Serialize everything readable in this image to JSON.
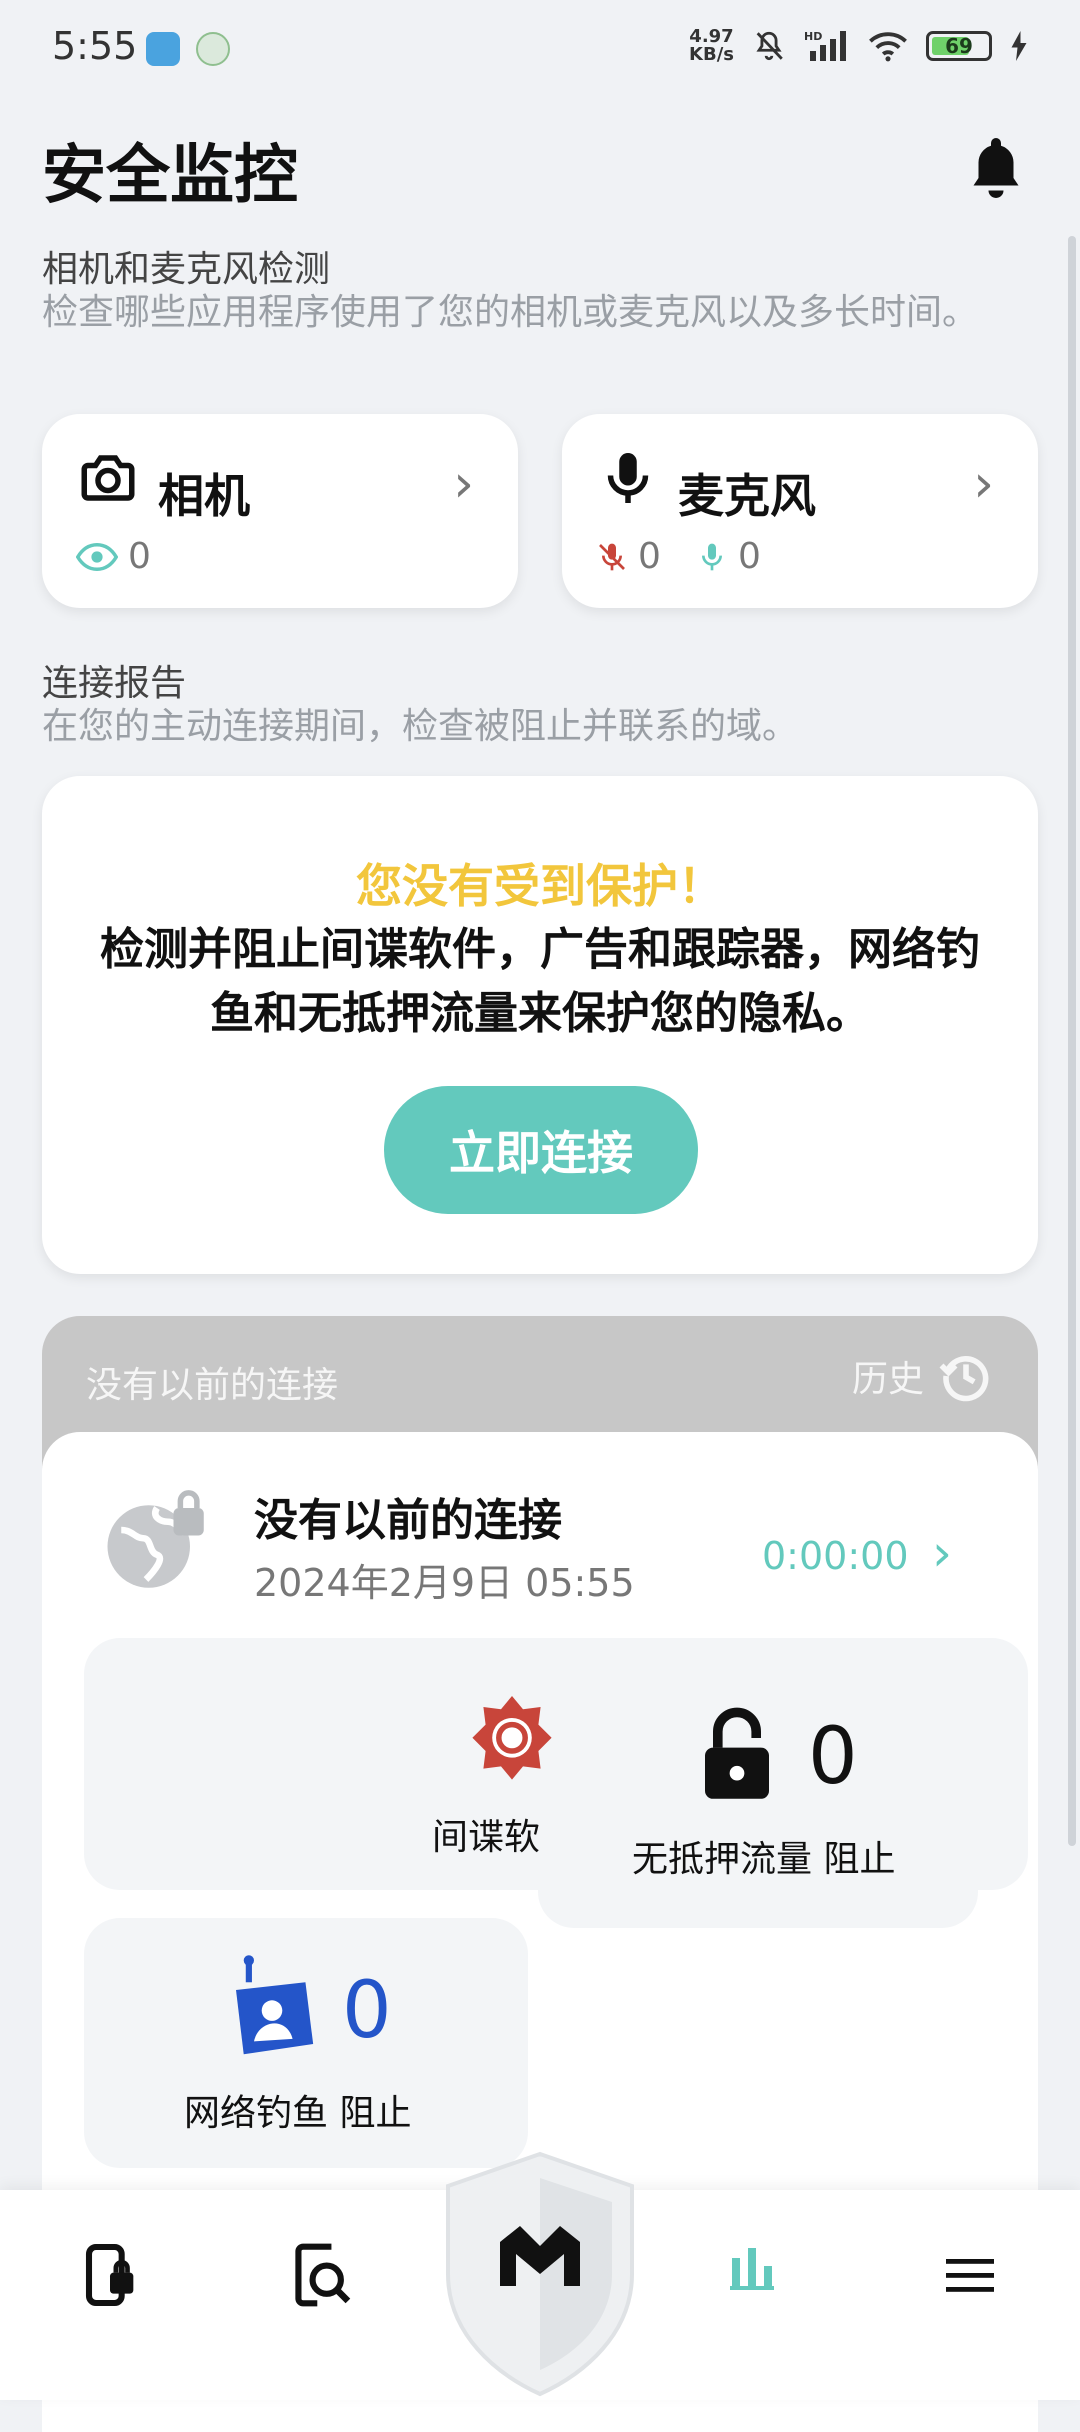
{
  "status_bar": {
    "time": "5:55",
    "net_speed_value": "4.97",
    "net_speed_unit": "KB/s",
    "signal_label": "HD",
    "battery": "69"
  },
  "header": {
    "title": "安全监控",
    "bell_icon": "bell-icon"
  },
  "camera_mic": {
    "title": "相机和麦克风检测",
    "subtitle": "检查哪些应用程序使用了您的相机或麦克风以及多长时间。",
    "camera": {
      "label": "相机",
      "views": "0"
    },
    "microphone": {
      "label": "麦克风",
      "blocked": "0",
      "active": "0"
    }
  },
  "connection_report": {
    "title": "连接报告",
    "subtitle": "在您的主动连接期间，检查被阻止并联系的域。",
    "warning": "您没有受到保护！",
    "description": "检测并阻止间谍软件，广告和跟踪器，网络钓鱼和无抵押流量来保护您的隐私。",
    "button": "立即连接"
  },
  "history": {
    "header": "没有以前的连接",
    "history_label": "历史",
    "entry": {
      "title": "没有以前的连接",
      "date": "2024年2月9日 05:55",
      "duration": "0:00:00"
    },
    "stats": {
      "spyware_label": "间谍软",
      "traffic_count": "0",
      "traffic_label": "无抵押流量 阻止",
      "phishing_count": "0",
      "phishing_label": "网络钓鱼 阻止"
    }
  },
  "nav": {
    "items": [
      "phone-lock-icon",
      "search-doc-icon",
      "shield-logo-icon",
      "stats-icon",
      "menu-icon"
    ],
    "active": "stats-icon",
    "accent": "#63c9bd"
  },
  "colors": {
    "accent": "#63c9bd",
    "warning": "#f2c63c",
    "phishing": "#2455c9",
    "spyware": "#c8453a"
  }
}
